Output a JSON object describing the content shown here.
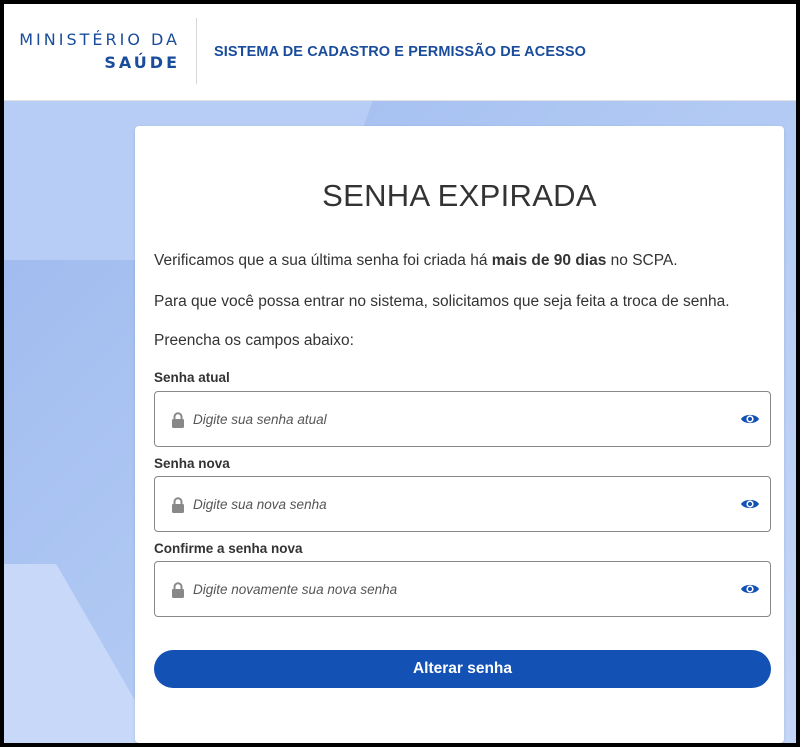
{
  "header": {
    "logo_line1": "MINISTÉRIO DA",
    "logo_line2": "SAÚDE",
    "title": "SISTEMA DE CADASTRO E PERMISSÃO DE ACESSO"
  },
  "card": {
    "title": "SENHA EXPIRADA",
    "para1_before": "Verificamos que a sua última senha foi criada há ",
    "para1_bold": "mais de 90 dias",
    "para1_after": " no SCPA.",
    "para2": "Para que você possa entrar no sistema, solicitamos que seja feita a troca de senha.",
    "para3": "Preencha os campos abaixo:"
  },
  "fields": {
    "current": {
      "label": "Senha atual",
      "placeholder": "Digite sua senha atual"
    },
    "new": {
      "label": "Senha nova",
      "placeholder": "Digite sua nova senha"
    },
    "confirm": {
      "label": "Confirme a senha nova",
      "placeholder": "Digite novamente sua nova senha"
    }
  },
  "submit_label": "Alterar senha",
  "colors": {
    "primary": "#1351b4",
    "brand_text": "#1a4c9c",
    "background": "#a7c1f0"
  },
  "icons": {
    "lock": "lock-icon",
    "eye": "eye-icon"
  }
}
